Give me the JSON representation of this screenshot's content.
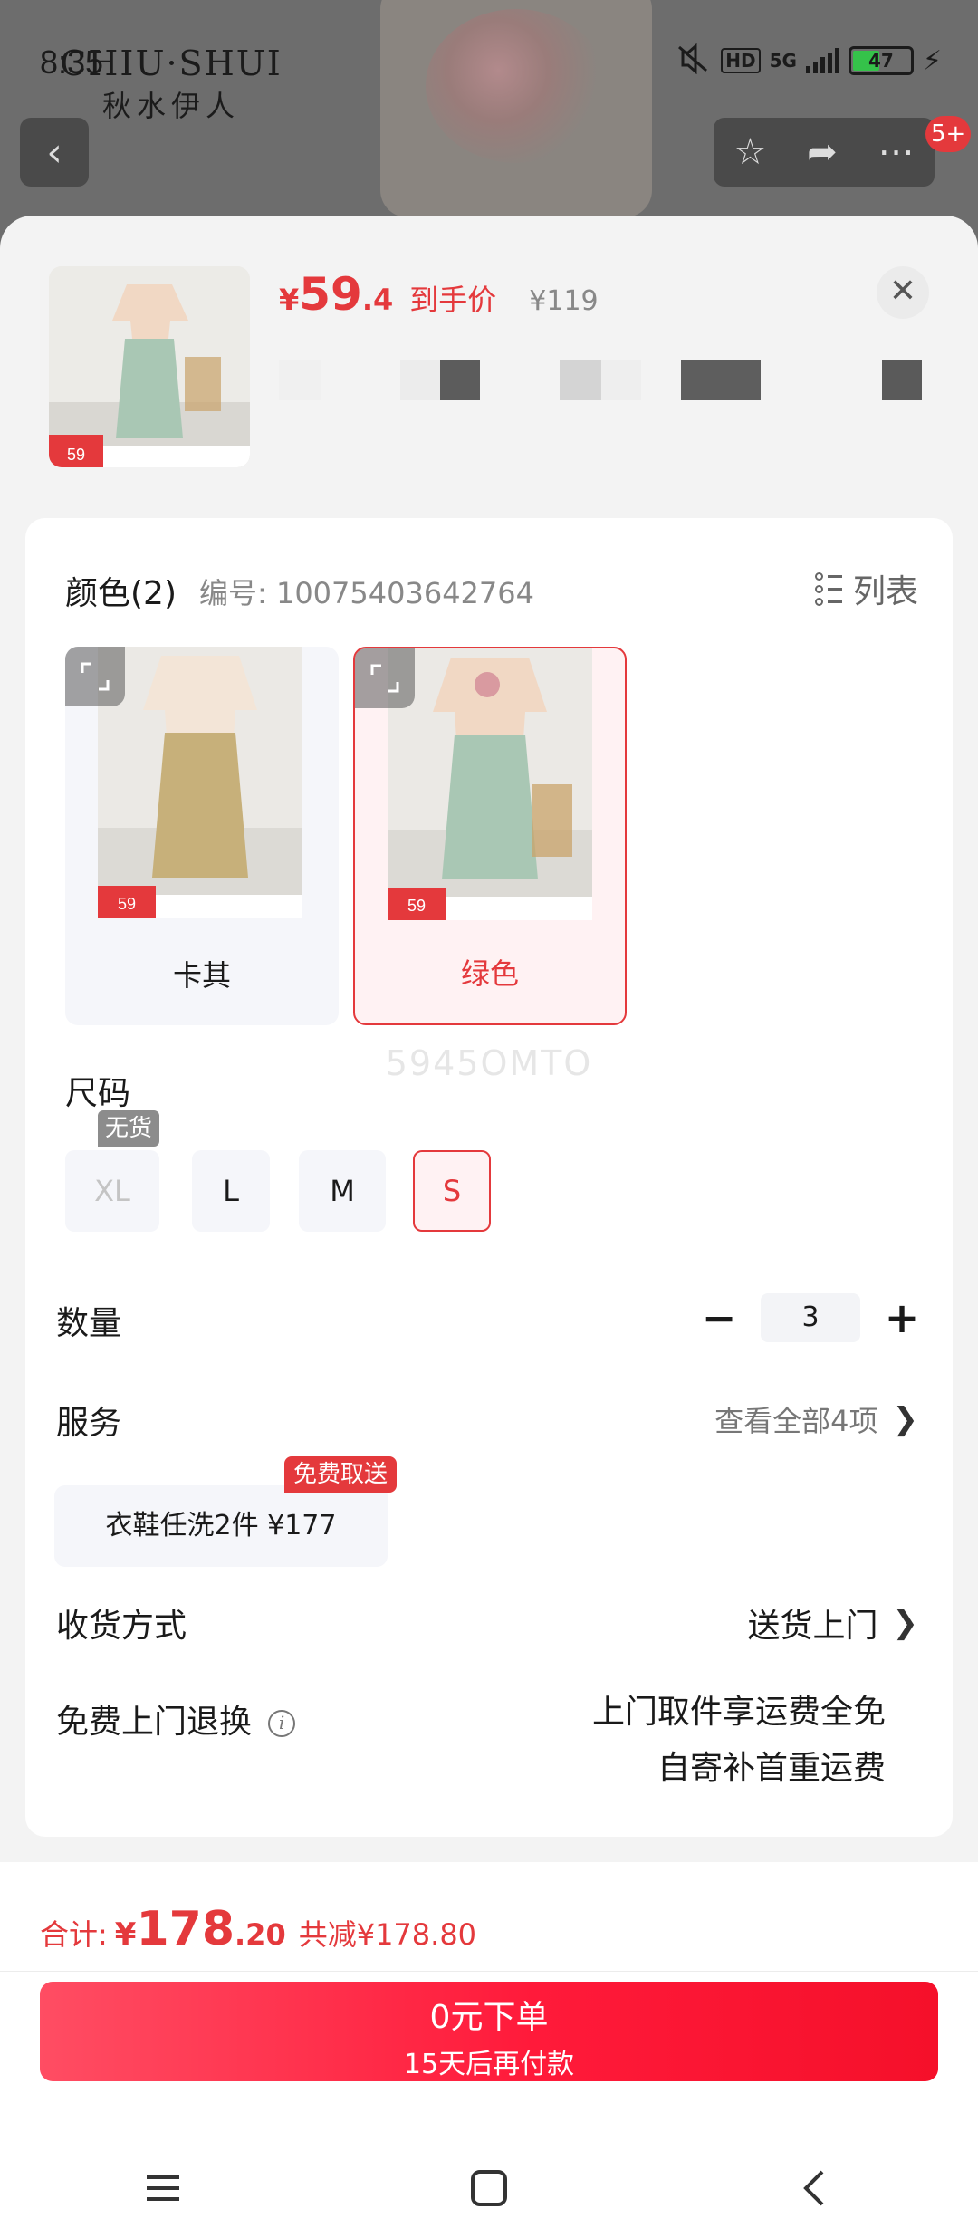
{
  "status_bar": {
    "time": "8:35",
    "network": "5G",
    "hd": "HD",
    "battery": "47"
  },
  "background": {
    "brand_en": "CHIU·SHUI",
    "brand_cn": "秋水伊人",
    "cart_badge": "5+"
  },
  "header": {
    "price_currency": "¥",
    "price_integer": "59",
    "price_decimal": ".4",
    "price_label": "到手价",
    "original_price": "¥119",
    "thumb_tag": "59"
  },
  "color_section": {
    "title": "颜色(2)",
    "sku_label": "编号: 10075403642764",
    "list_toggle": "列表",
    "options": [
      {
        "label": "卡其",
        "swatch": "#c7b07a",
        "selected": false
      },
      {
        "label": "绿色",
        "swatch": "#a9c7b4",
        "selected": true
      }
    ],
    "promo_price": "59"
  },
  "watermark": "5945OMTO",
  "size_section": {
    "title": "尺码",
    "out_of_stock_tag": "无货",
    "options": [
      {
        "label": "XL",
        "state": "out_of_stock"
      },
      {
        "label": "L",
        "state": "normal"
      },
      {
        "label": "M",
        "state": "normal"
      },
      {
        "label": "S",
        "state": "selected"
      }
    ]
  },
  "quantity": {
    "title": "数量",
    "minus": "−",
    "value": "3",
    "plus": "+"
  },
  "service": {
    "title": "服务",
    "view_all": "查看全部4项",
    "chip_label": "衣鞋任洗2件  ¥177",
    "free_tag": "免费取送"
  },
  "delivery": {
    "title": "收货方式",
    "value": "送货上门"
  },
  "free_return": {
    "title": "免费上门退换",
    "line1": "上门取件享运费全免",
    "line2": "自寄补首重运费"
  },
  "footer": {
    "total_label": "合计:",
    "total_currency": "¥",
    "total_integer": "178",
    "total_decimal": ".20",
    "discount": "共减¥178.80",
    "order_line1": "0元下单",
    "order_line2": "15天后再付款"
  },
  "colors": {
    "accent": "#e4393c",
    "selected_bg": "#fff2f3",
    "option_bg": "#f5f6fa"
  }
}
